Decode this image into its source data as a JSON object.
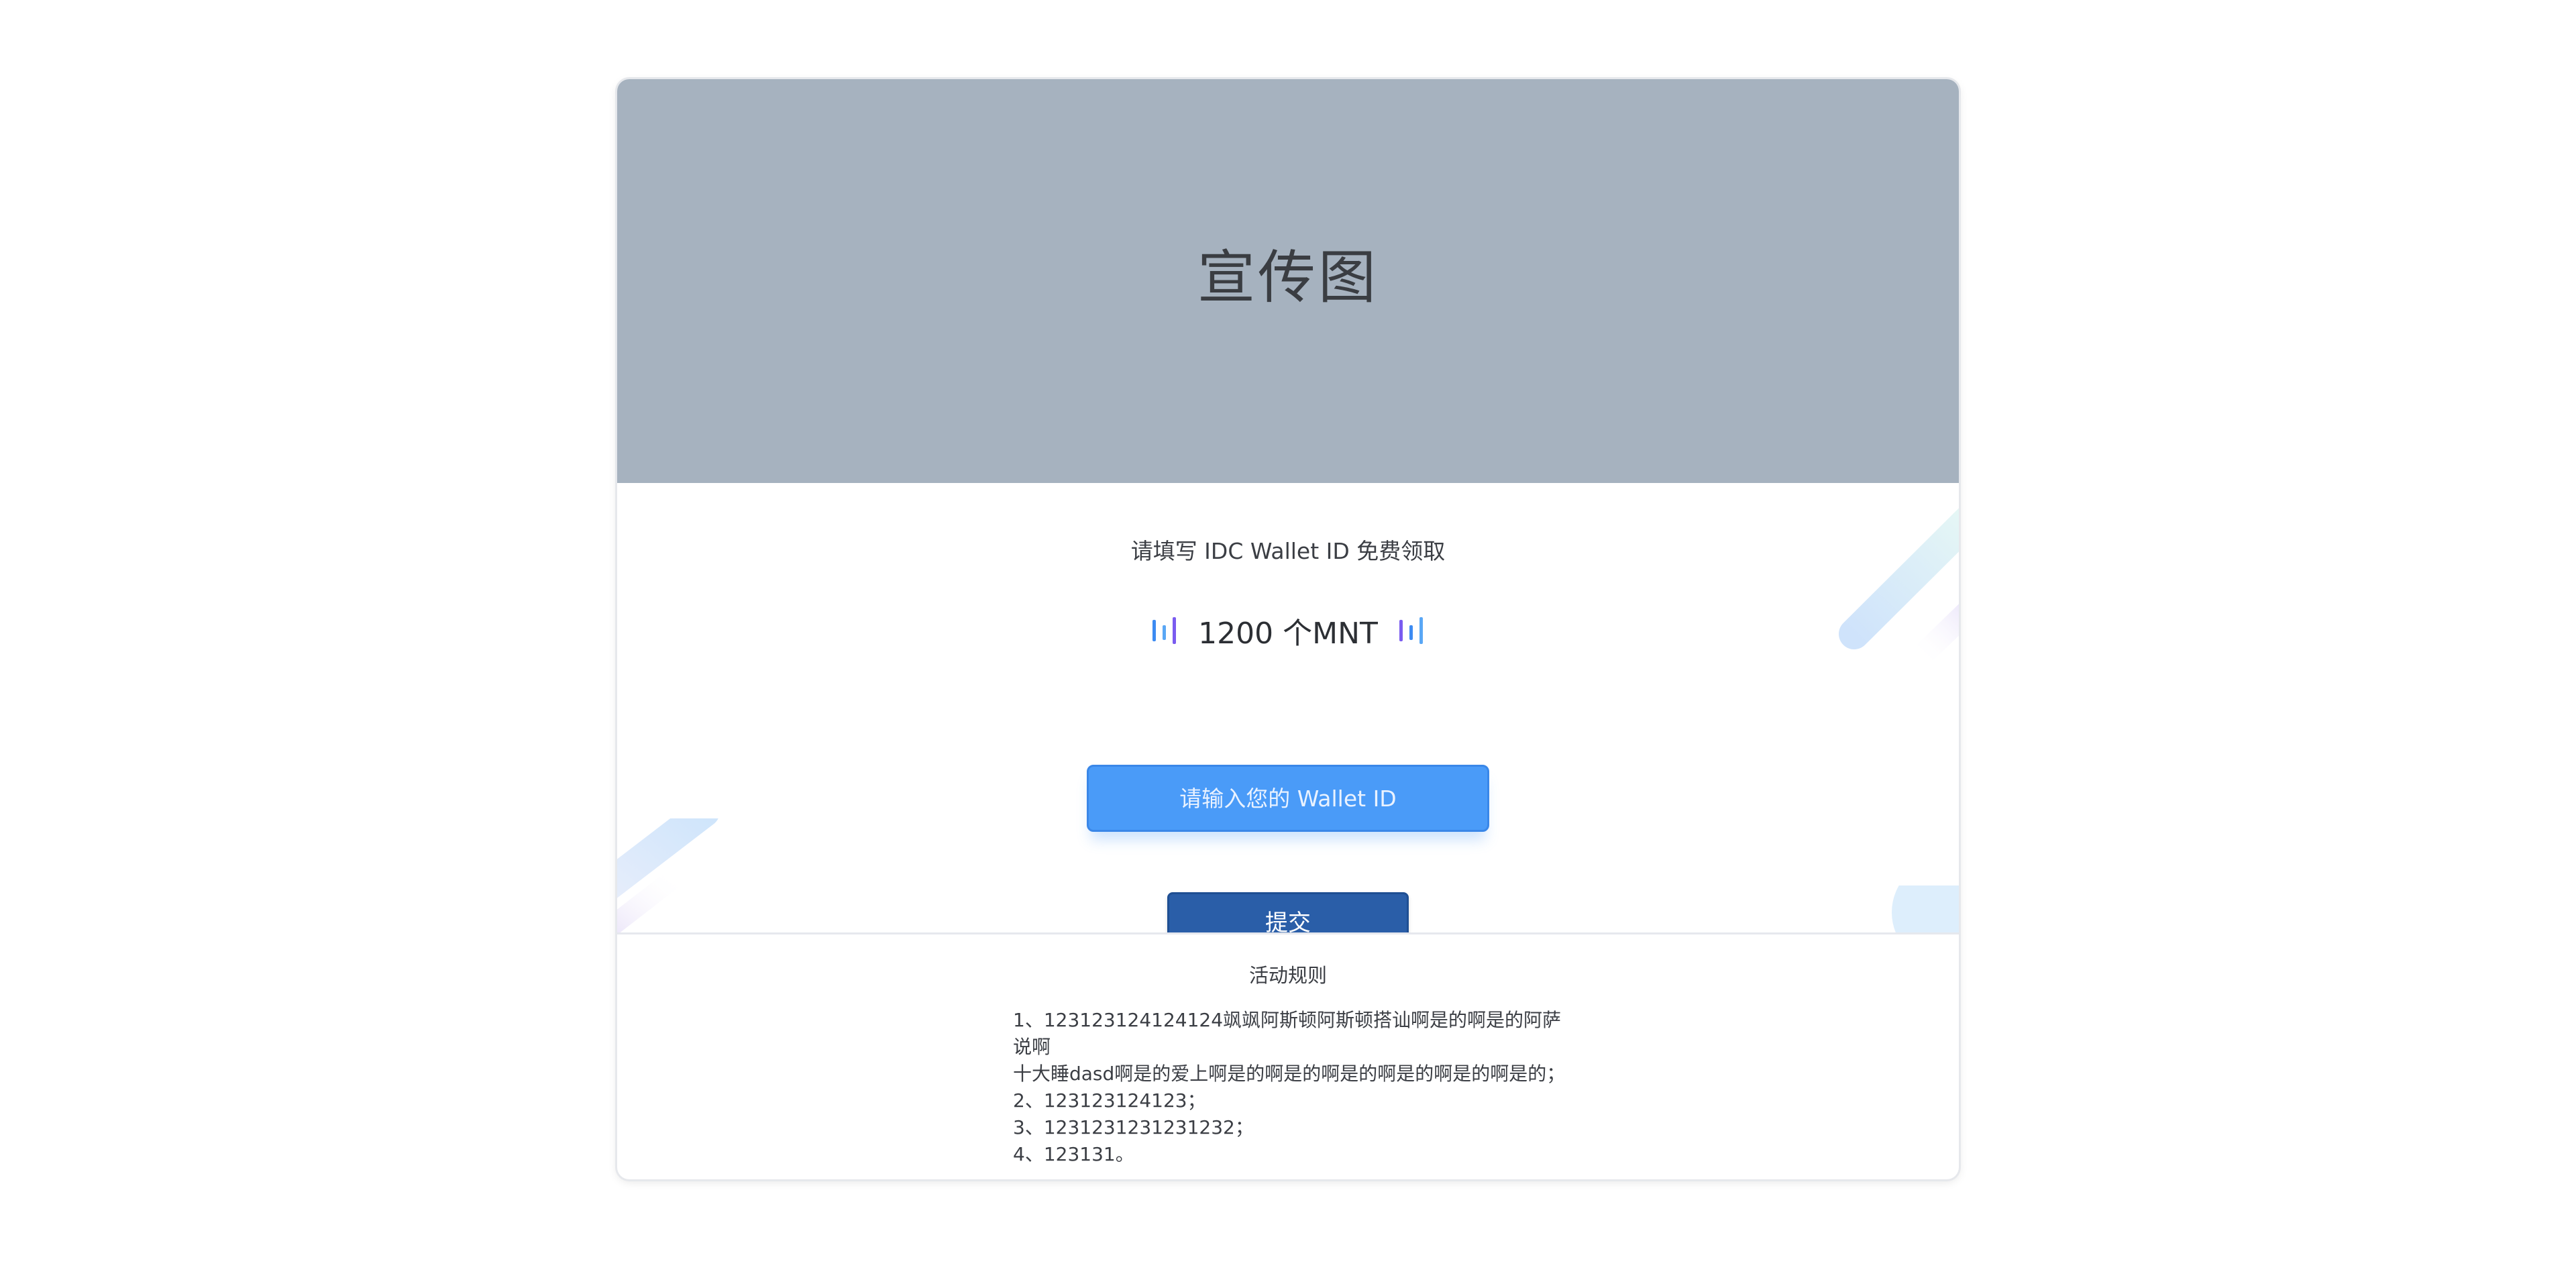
{
  "banner": {
    "title": "宣传图"
  },
  "claim": {
    "subtitle": "请填写 IDC Wallet ID 免费领取",
    "amount": "1200 个MNT",
    "input_placeholder": "请输入您的 Wallet ID",
    "submit_label": "提交"
  },
  "rules": {
    "title": "活动规则",
    "items": [
      "1、123123124124124飒飒阿斯顿阿斯顿搭讪啊是的啊是的阿萨说啊",
      "十大睡dasd啊是的爱上啊是的啊是的啊是的啊是的啊是的啊是的；",
      "2、123123124123；",
      "3、1231231231231232；",
      "4、123131。"
    ]
  },
  "colors": {
    "banner_bg": "#a6b2bf",
    "input_bg": "#4a9bf8",
    "button_bg": "#2a5ea8",
    "icon_blue": "#3d8bf2",
    "icon_purple": "#7a5cf0"
  },
  "icons": {
    "amount_left": "bars-icon",
    "amount_right": "bars-icon"
  }
}
